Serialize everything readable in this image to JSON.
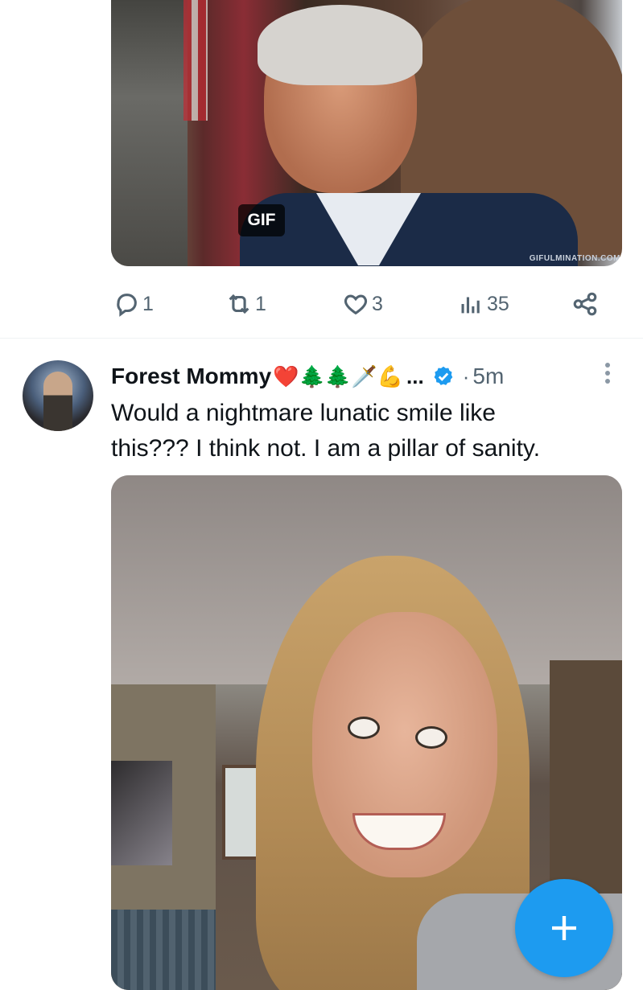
{
  "previous_tweet": {
    "media": {
      "badge": "GIF",
      "watermark": "GIFULMINATION.COM"
    },
    "actions": {
      "replies": "1",
      "reposts": "1",
      "likes": "3",
      "views": "35"
    }
  },
  "tweet": {
    "author_name": "Forest Mommy",
    "author_emojis": "❤️🌲🌲🗡️💪",
    "truncation": "...",
    "verified": true,
    "separator": "·",
    "time": "5m",
    "text_line1": "Would a nightmare lunatic smile like",
    "text_line2": "this???  I think not.  I am a pillar of sanity."
  },
  "colors": {
    "accent": "#1d9bf0",
    "secondary_text": "#536471",
    "primary_text": "#0f1419"
  },
  "icons": {
    "reply": "reply-icon",
    "repost": "repost-icon",
    "like": "heart-icon",
    "views": "views-icon",
    "share": "share-icon",
    "verified": "verified-badge-icon",
    "more": "more-icon",
    "compose": "plus-icon"
  }
}
